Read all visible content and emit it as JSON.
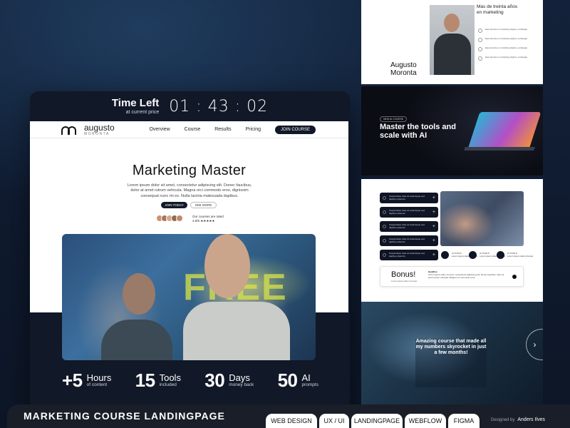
{
  "timer": {
    "label": "Time Left",
    "sublabel": "at current price",
    "hours": "01",
    "minutes": "43",
    "seconds": "02"
  },
  "nav": {
    "logo_name": "augusto",
    "logo_sub": "MORONTA",
    "links": [
      "Overview",
      "Course",
      "Results",
      "Pricing"
    ],
    "cta": "JOIN COURSE"
  },
  "hero": {
    "title": "Marketing Master",
    "subtitle": "Lorem ipsum dolor sit amet, consectetur adipiscing elit. Donec faucibus, dolor at amet rutrum vehicula. Magna orci commodo eros, dignissim consequat nunc mi ex. Nulla lacinia malesuada dapibus.",
    "primary_button": "JOIN TODAY",
    "secondary_button": "SEE MORE",
    "social_proof": "Our courses are rated",
    "rating": "4.9/5 ★★★★★"
  },
  "photo_text": "FREE",
  "stats": [
    {
      "num": "+5",
      "label": "Hours",
      "sub": "of content"
    },
    {
      "num": "15",
      "label": "Tools",
      "sub": "included"
    },
    {
      "num": "30",
      "label": "Days",
      "sub": "money back"
    },
    {
      "num": "50",
      "label": "AI",
      "sub": "prompts"
    }
  ],
  "panel_about": {
    "name_line1": "Augusto",
    "name_line2": "Moronta",
    "heading_line1": "Mas de treinta años",
    "heading_line2": "en marketing",
    "items": [
      "Experiencia en marketing digital y estrategia",
      "Experiencia en marketing digital y estrategia",
      "Experiencia en marketing digital y estrategia",
      "Experiencia en marketing digital y estrategia"
    ]
  },
  "panel_tools": {
    "tag": "NEW AI COURSE",
    "title": "Master the tools and scale with AI"
  },
  "panel_features": {
    "accordion": [
      "Suspendisse vitae sit scelerisque sed dapibus pharetra",
      "Suspendisse vitae sit scelerisque sed dapibus pharetra",
      "Suspendisse vitae sit scelerisque sed dapibus pharetra",
      "Suspendisse vitae sit scelerisque sed dapibus pharetra",
      "Suspendisse vitae sit scelerisque sed dapibus pharetra"
    ],
    "tools": [
      {
        "title": "AI TOOLS",
        "desc": "Lorem ipsum dolor sit amet"
      },
      {
        "title": "AI TOOLS",
        "desc": "Lorem ipsum dolor sit amet"
      },
      {
        "title": "AI TOOLS",
        "desc": "Lorem ipsum dolor sit amet"
      }
    ],
    "bonus_title": "Bonus!",
    "bonus_sub": "Lorem ipsum dolor sit amet",
    "bonus_heading": "Headline",
    "bonus_desc": "Lorem ipsum dolor sit amet, consectetur adipiscing elit. Donec faucibus, dolor at amet rutrum vehicula. Magna orci commodo eros."
  },
  "panel_testimonial": {
    "text": "Amazing course that made all my numbers skyrocket in just a few months!",
    "arrow": "›"
  },
  "footer": {
    "title": "MARKETING COURSE LANDINGPAGE",
    "tags": [
      "WEB DESIGN",
      "UX / UI",
      "LANDINGPAGE",
      "WEBFLOW",
      "FIGMA"
    ],
    "designed_by_label": "Designed by",
    "designed_by_name": "Anders Ilves"
  }
}
